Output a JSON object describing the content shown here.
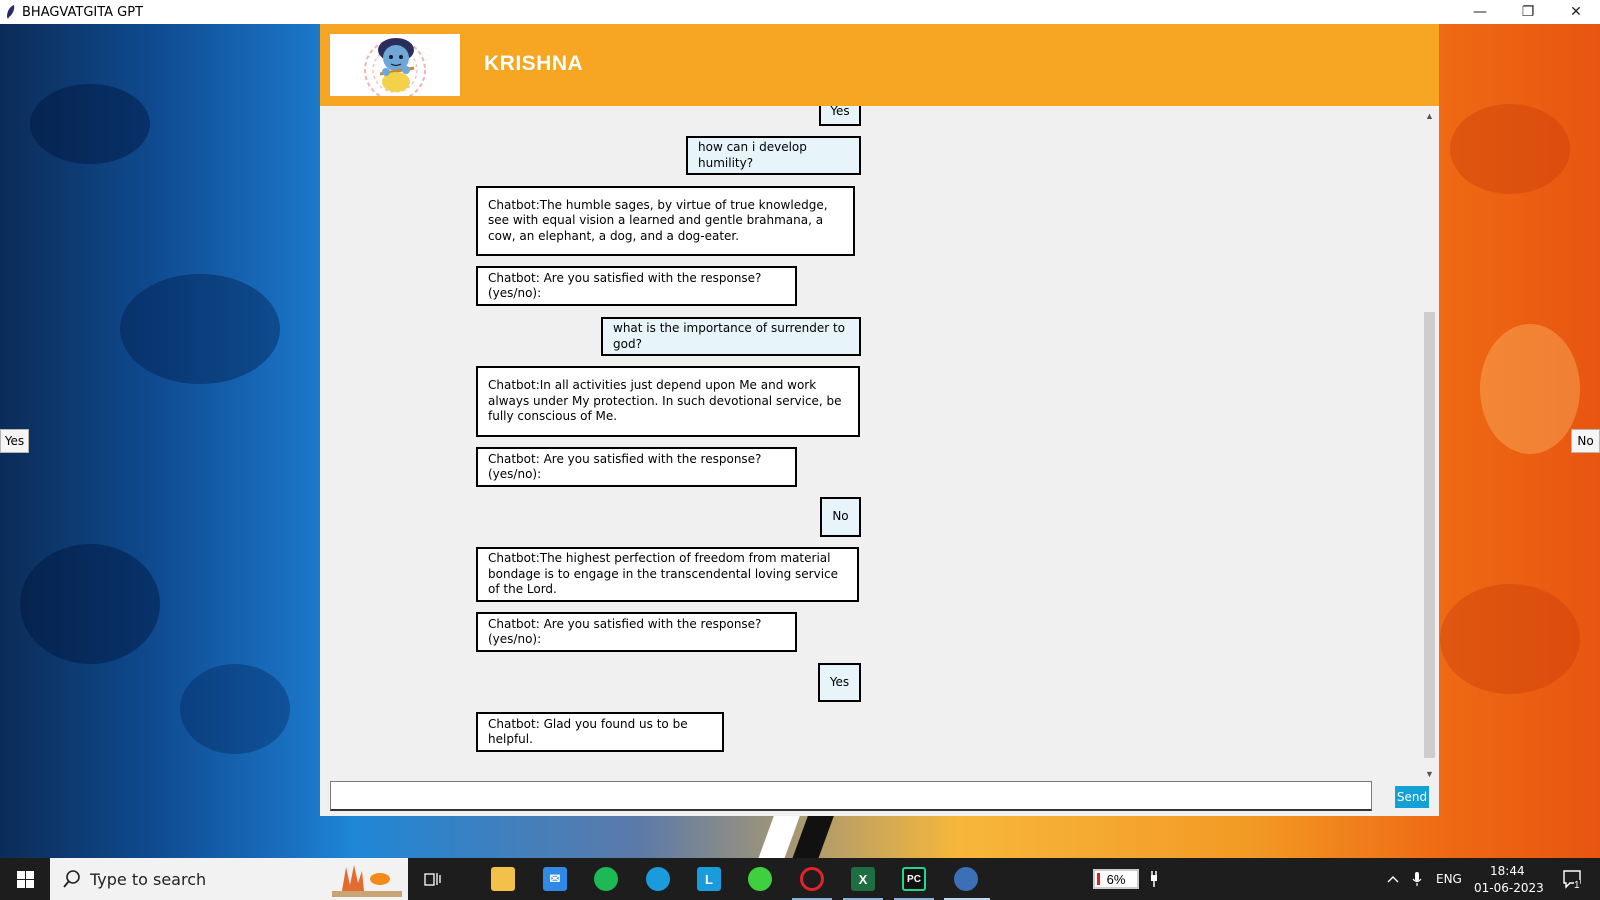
{
  "window": {
    "title": "BHAGVATGITA GPT",
    "controls": {
      "minimize": "—",
      "restore": "❐",
      "close": "✕"
    }
  },
  "header": {
    "name": "KRISHNA"
  },
  "side_buttons": {
    "left": "Yes",
    "right": "No"
  },
  "messages": [
    {
      "sender": "user",
      "text": "Yes"
    },
    {
      "sender": "user",
      "text": "how can i develop humility?"
    },
    {
      "sender": "bot",
      "text": "Chatbot:The humble sages, by virtue of true knowledge, see with equal vision a learned and gentle brahmana, a cow, an elephant, a dog, and a dog-eater."
    },
    {
      "sender": "bot",
      "text": "Chatbot: Are you satisfied with the response? (yes/no):"
    },
    {
      "sender": "user",
      "text": "what is the importance of surrender to god?"
    },
    {
      "sender": "bot",
      "text": "Chatbot:In all activities just depend upon Me and work always under My protection. In such devotional service, be fully conscious of Me."
    },
    {
      "sender": "bot",
      "text": "Chatbot: Are you satisfied with the response? (yes/no):"
    },
    {
      "sender": "user",
      "text": "No"
    },
    {
      "sender": "bot",
      "text": "Chatbot:The highest perfection of freedom from material bondage is to engage in the transcendental loving service of the Lord."
    },
    {
      "sender": "bot",
      "text": "Chatbot: Are you satisfied with the response? (yes/no):"
    },
    {
      "sender": "user",
      "text": "Yes"
    },
    {
      "sender": "bot",
      "text": "Chatbot: Glad you found us to be helpful."
    }
  ],
  "composer": {
    "value": "",
    "send_label": "Send"
  },
  "taskbar": {
    "search_placeholder": "Type to search",
    "battery": "6%",
    "language": "ENG",
    "time": "18:44",
    "date": "01-06-2023",
    "notification_count": "1",
    "pinned_apps": [
      "windows-start",
      "search",
      "task-view",
      "file-explorer",
      "mail",
      "spotify",
      "edge",
      "l-app",
      "green-app",
      "opera",
      "excel",
      "pycharm",
      "python"
    ],
    "colors": {
      "spotify": "#1db954",
      "excel": "#1d6f42",
      "opera": "#e0242c",
      "edge": "#1a9bdb",
      "pycharm": "#21d789"
    }
  },
  "colors": {
    "header": "#f6a623",
    "send_button": "#13a1d5",
    "user_bubble": "#e7f5fb",
    "bot_bubble": "#ffffff"
  }
}
